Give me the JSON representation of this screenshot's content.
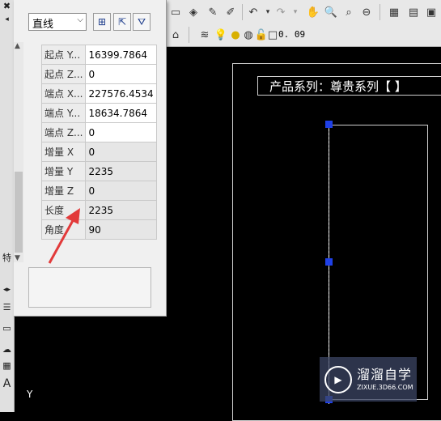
{
  "properties_panel": {
    "object_type": "直线",
    "rows": [
      {
        "label": "起点 Y...",
        "value": "16399.7864",
        "editable": true
      },
      {
        "label": "起点 Z...",
        "value": "0",
        "editable": true
      },
      {
        "label": "端点 X...",
        "value": "227576.4534",
        "editable": true
      },
      {
        "label": "端点 Y...",
        "value": "18634.7864",
        "editable": true
      },
      {
        "label": "端点 Z...",
        "value": "0",
        "editable": true
      },
      {
        "label": "增量 X",
        "value": "0",
        "editable": false
      },
      {
        "label": "增量 Y",
        "value": "2235",
        "editable": false
      },
      {
        "label": "增量 Z",
        "value": "0",
        "editable": false
      },
      {
        "label": "长度",
        "value": "2235",
        "editable": false
      },
      {
        "label": "角度",
        "value": "90",
        "editable": false
      }
    ]
  },
  "toolbar": {
    "lineweight_value": "0. 09"
  },
  "drawing": {
    "title_text": "产品系列：尊贵系列【 】",
    "axis_label": "Y"
  },
  "watermark": {
    "brand": "溜溜自学",
    "url": "ZIXUE.3D66.COM"
  },
  "colors": {
    "canvas": "#000000",
    "grip": "#1f40e6"
  }
}
